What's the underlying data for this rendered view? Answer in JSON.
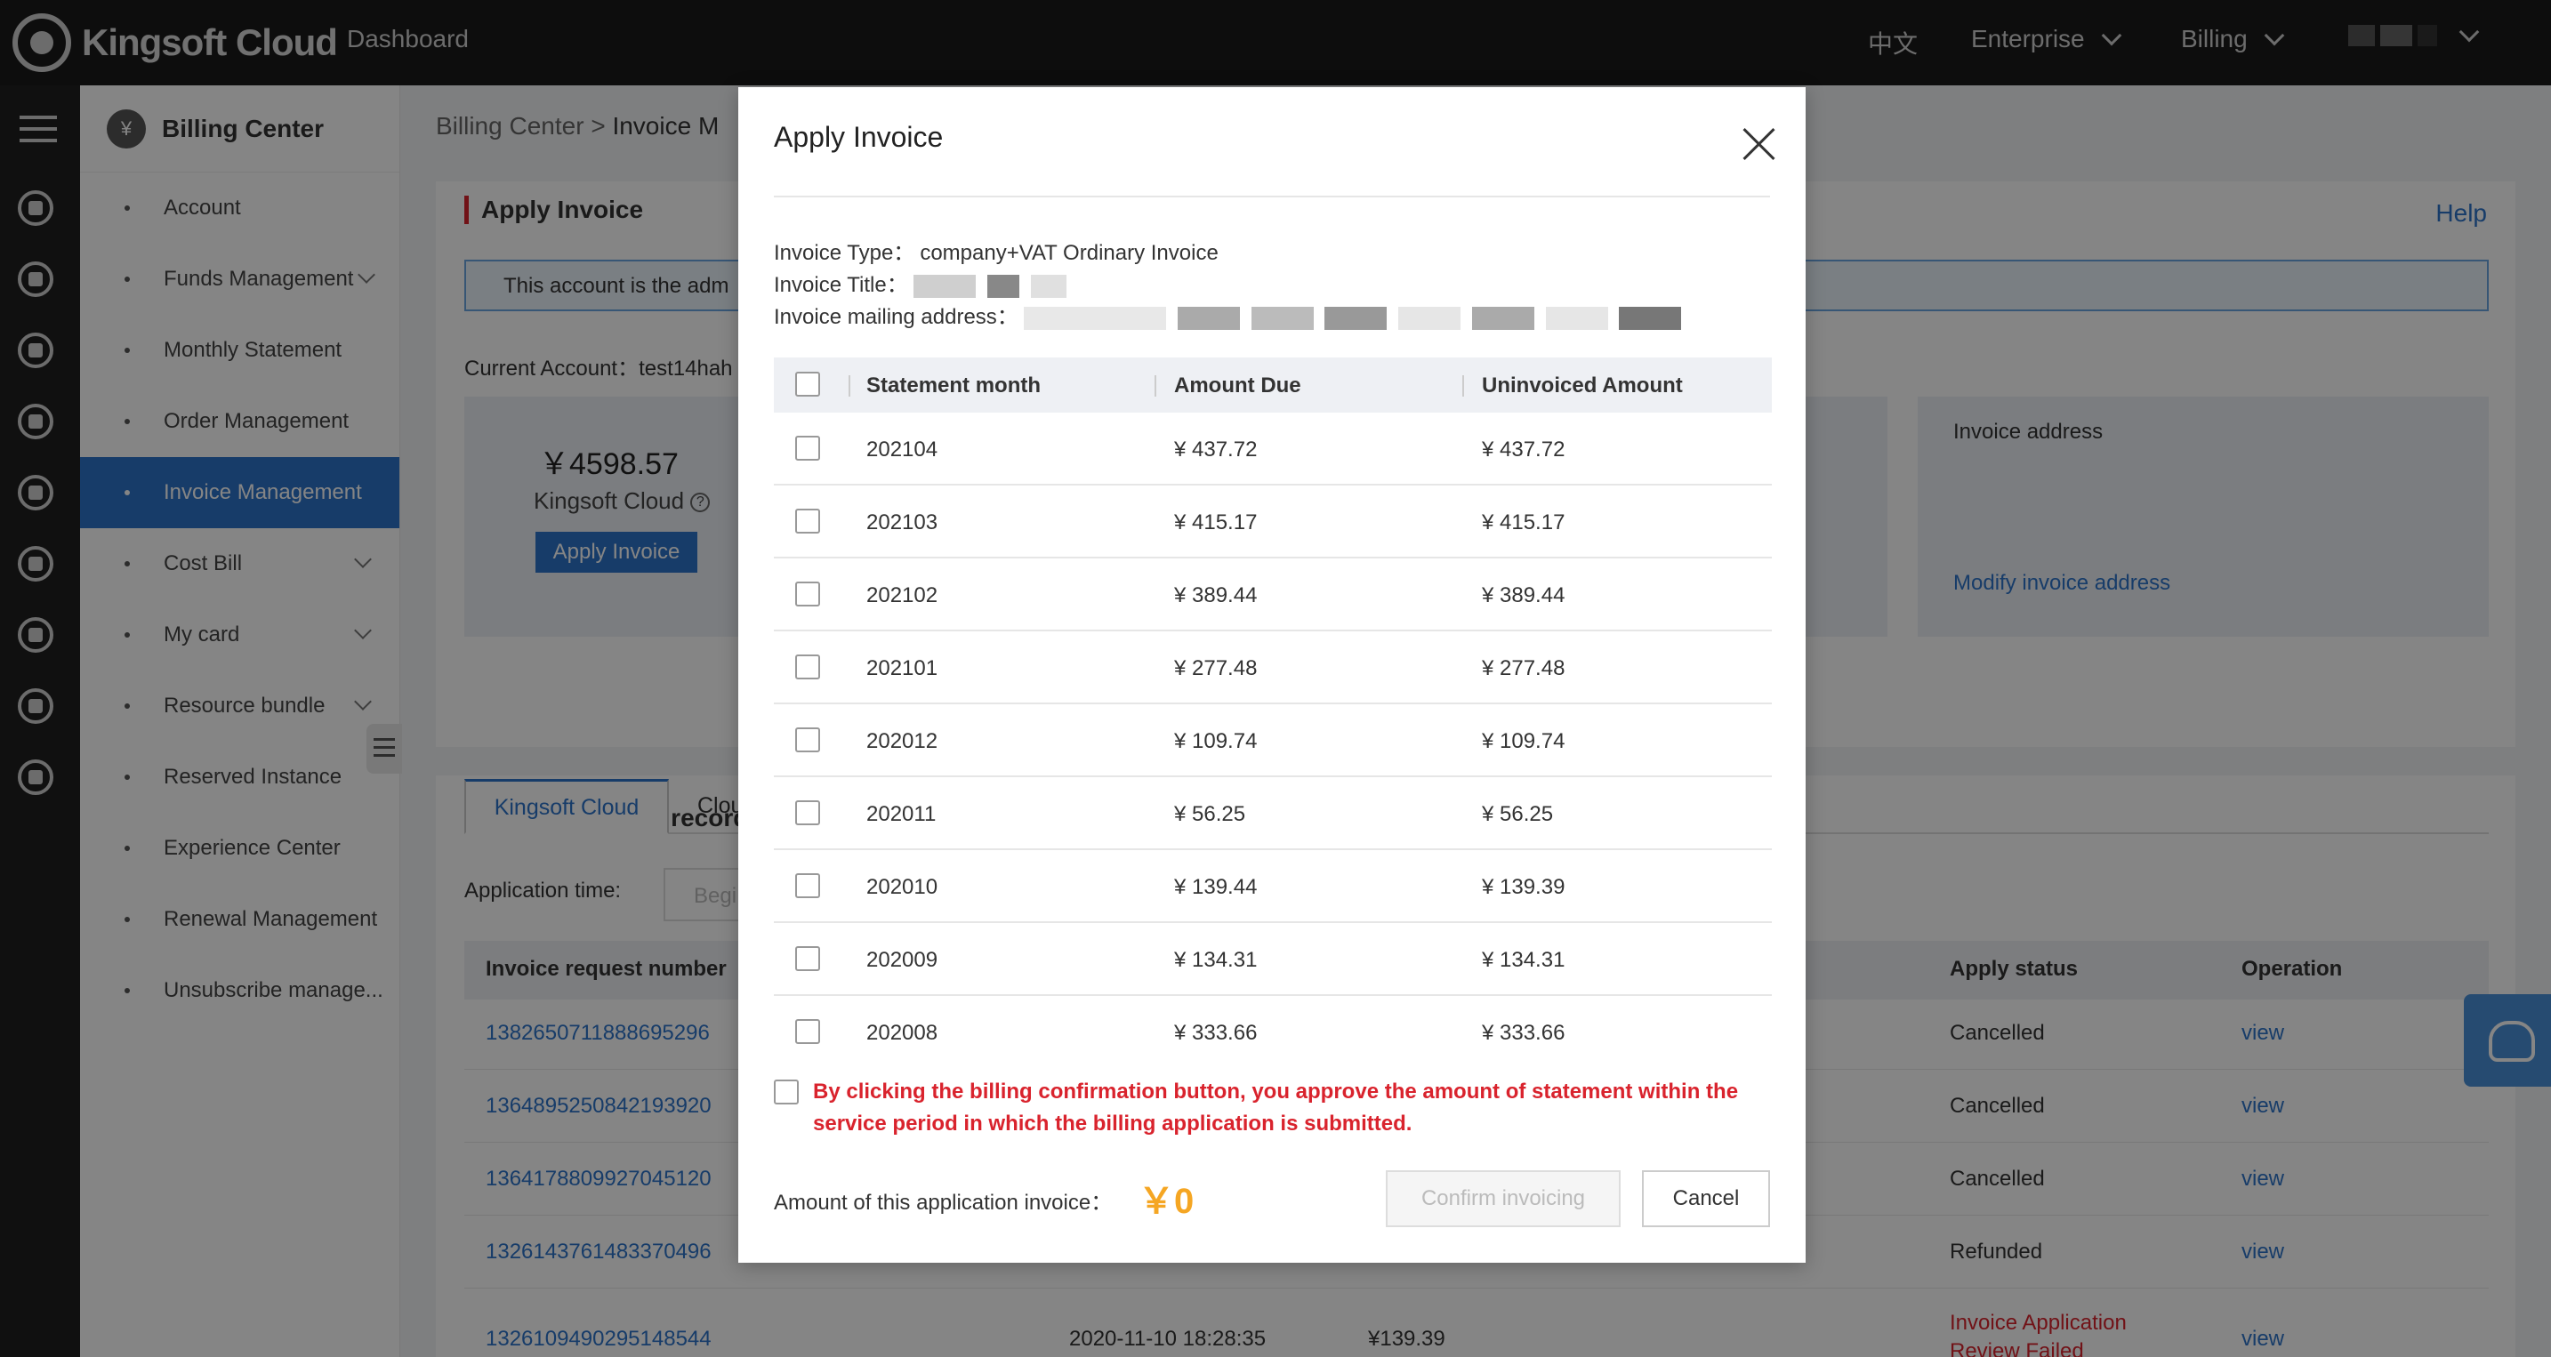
{
  "topbar": {
    "logo_text": "Kingsoft Cloud",
    "dashboard": "Dashboard",
    "lang": "中文",
    "enterprise": "Enterprise",
    "billing": "Billing"
  },
  "sidenav": {
    "title": "Billing Center",
    "items": [
      {
        "label": "Account"
      },
      {
        "label": "Funds Management"
      },
      {
        "label": "Monthly Statement"
      },
      {
        "label": "Order Management"
      },
      {
        "label": "Invoice Management"
      },
      {
        "label": "Cost Bill"
      },
      {
        "label": "My card"
      },
      {
        "label": "Resource bundle"
      },
      {
        "label": "Reserved Instance"
      },
      {
        "label": "Experience Center"
      },
      {
        "label": "Renewal Management"
      },
      {
        "label": "Unsubscribe manage..."
      }
    ]
  },
  "main": {
    "breadcrumb_root": "Billing Center",
    "breadcrumb_sep": ">",
    "breadcrumb_current": "Invoice M",
    "section_title": "Apply Invoice",
    "help": "Help",
    "banner": "This account is the adm",
    "current_account": "Current Account：test14hah",
    "amount": "￥4598.57",
    "kingsoft_cloud": "Kingsoft Cloud",
    "apply_button": "Apply Invoice",
    "invoice_address_title": "Invoice address",
    "modify_address": "Modify invoice address",
    "records_title": "Invoice request record",
    "tab_kingsoft": "Kingsoft Cloud",
    "tab_other": "Clou",
    "application_time": "Application time:",
    "date_placeholder": "Begi",
    "columns": {
      "request_number": "Invoice request number",
      "apply_status": "Apply status",
      "operation": "Operation"
    },
    "rows": [
      {
        "number": "1382650711888695296",
        "status": "Cancelled",
        "op": "view"
      },
      {
        "number": "1364895250842193920",
        "status": "Cancelled",
        "op": "view"
      },
      {
        "number": "1364178809927045120",
        "status": "Cancelled",
        "op": "view"
      },
      {
        "number": "1326143761483370496",
        "status": "Refunded",
        "op": "view"
      },
      {
        "number": "1326109490295148544",
        "status": "Invoice Application Review Failed",
        "op": "view",
        "date": "2020-11-10 18:28:35",
        "amount": "¥139.39"
      }
    ]
  },
  "modal": {
    "title": "Apply Invoice",
    "invoice_type_label": "Invoice Type：",
    "invoice_type_value": "company+VAT Ordinary Invoice",
    "invoice_title_label": "Invoice Title：",
    "mailing_label": "Invoice mailing address：",
    "columns": {
      "month": "Statement month",
      "due": "Amount Due",
      "uninvoiced": "Uninvoiced Amount"
    },
    "rows": [
      {
        "month": "202104",
        "due": "¥ 437.72",
        "uninvoiced": "¥ 437.72"
      },
      {
        "month": "202103",
        "due": "¥ 415.17",
        "uninvoiced": "¥ 415.17"
      },
      {
        "month": "202102",
        "due": "¥ 389.44",
        "uninvoiced": "¥ 389.44"
      },
      {
        "month": "202101",
        "due": "¥ 277.48",
        "uninvoiced": "¥ 277.48"
      },
      {
        "month": "202012",
        "due": "¥ 109.74",
        "uninvoiced": "¥ 109.74"
      },
      {
        "month": "202011",
        "due": "¥ 56.25",
        "uninvoiced": "¥ 56.25"
      },
      {
        "month": "202010",
        "due": "¥ 139.44",
        "uninvoiced": "¥ 139.39"
      },
      {
        "month": "202009",
        "due": "¥ 134.31",
        "uninvoiced": "¥ 134.31"
      },
      {
        "month": "202008",
        "due": "¥ 333.66",
        "uninvoiced": "¥ 333.66"
      }
    ],
    "agreement": "By clicking the billing confirmation button, you approve the amount of statement within the service period in which the billing application is submitted.",
    "amount_label": "Amount of this application invoice：",
    "amount_value": "￥0",
    "confirm": "Confirm invoicing",
    "cancel": "Cancel"
  }
}
